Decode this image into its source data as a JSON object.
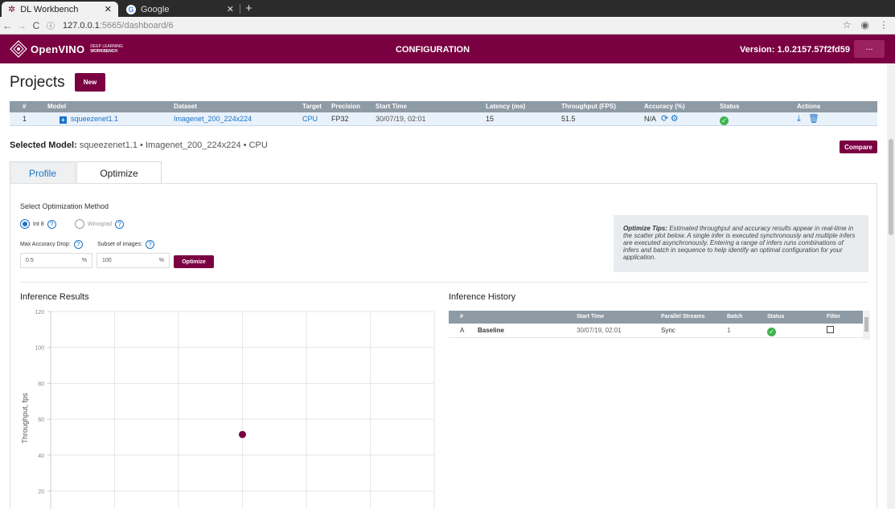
{
  "browser": {
    "tabs": [
      {
        "title": "DL Workbench",
        "active": true
      },
      {
        "title": "Google",
        "active": false
      }
    ],
    "url_host": "127.0.0.1",
    "url_path": ":5665/dashboard/6"
  },
  "header": {
    "logo_text": "OpenVINO",
    "logo_sub_1": "DEEP LEARNING",
    "logo_sub_2": "WORKBENCH",
    "title": "CONFIGURATION",
    "version": "Version: 1.0.2157.57f2fd59",
    "more_label": "..."
  },
  "projects": {
    "title": "Projects",
    "new_label": "New",
    "columns": [
      "#",
      "Model",
      "Dataset",
      "Target",
      "Precision",
      "Start Time",
      "Latency (ms)",
      "Throughput (FPS)",
      "Accuracy (%)",
      "Status",
      "Actions"
    ],
    "rows": [
      {
        "num": "1",
        "model": "squeezenet1.1",
        "dataset": "Imagenet_200_224x224",
        "target": "CPU",
        "precision": "FP32",
        "start_time": "30/07/19, 02:01",
        "latency": "15",
        "throughput": "51.5",
        "accuracy": "N/A"
      }
    ]
  },
  "selected": {
    "label": "Selected Model:",
    "value": "squeezenet1.1 • Imagenet_200_224x224 • CPU",
    "compare_label": "Compare"
  },
  "tabs": {
    "profile": "Profile",
    "optimize": "Optimize"
  },
  "optimize": {
    "section_title": "Select Optimization Method",
    "method_int8": "Int 8",
    "method_winograd": "Winograd",
    "max_drop_label": "Max Accuracy Drop:",
    "subset_label": "Subset of images:",
    "max_drop_value": "0.5",
    "subset_value": "100",
    "unit": "%",
    "button_label": "Optimize",
    "tips_title": "Optimize Tips:",
    "tips_text": " Estimated throughput and accuracy results appear in real-time in the scatter plot below. A single infer is executed synchronously and multiple infers are executed asynchronously. Entering a range of infers runs combinations of infers and batch in sequence to help identify an optimal configuration for your application."
  },
  "results": {
    "title": "Inference Results"
  },
  "history": {
    "title": "Inference History",
    "columns": [
      "#",
      "Start Time",
      "Parallel Streams",
      "Batch",
      "Status",
      "Filter"
    ],
    "rows": [
      {
        "id": "A",
        "name": "Baseline",
        "start_time": "30/07/19, 02:01",
        "streams": "Sync",
        "batch": "1"
      }
    ]
  },
  "chart_data": {
    "type": "scatter",
    "ylabel": "Throughput, fps",
    "yticks": [
      20,
      40,
      60,
      80,
      100,
      120
    ],
    "ylim": [
      10,
      120
    ],
    "grid": true,
    "points": [
      {
        "x": 0.5,
        "y": 51.5
      }
    ],
    "xlim": [
      0,
      1
    ],
    "point_color": "#7a0041"
  }
}
